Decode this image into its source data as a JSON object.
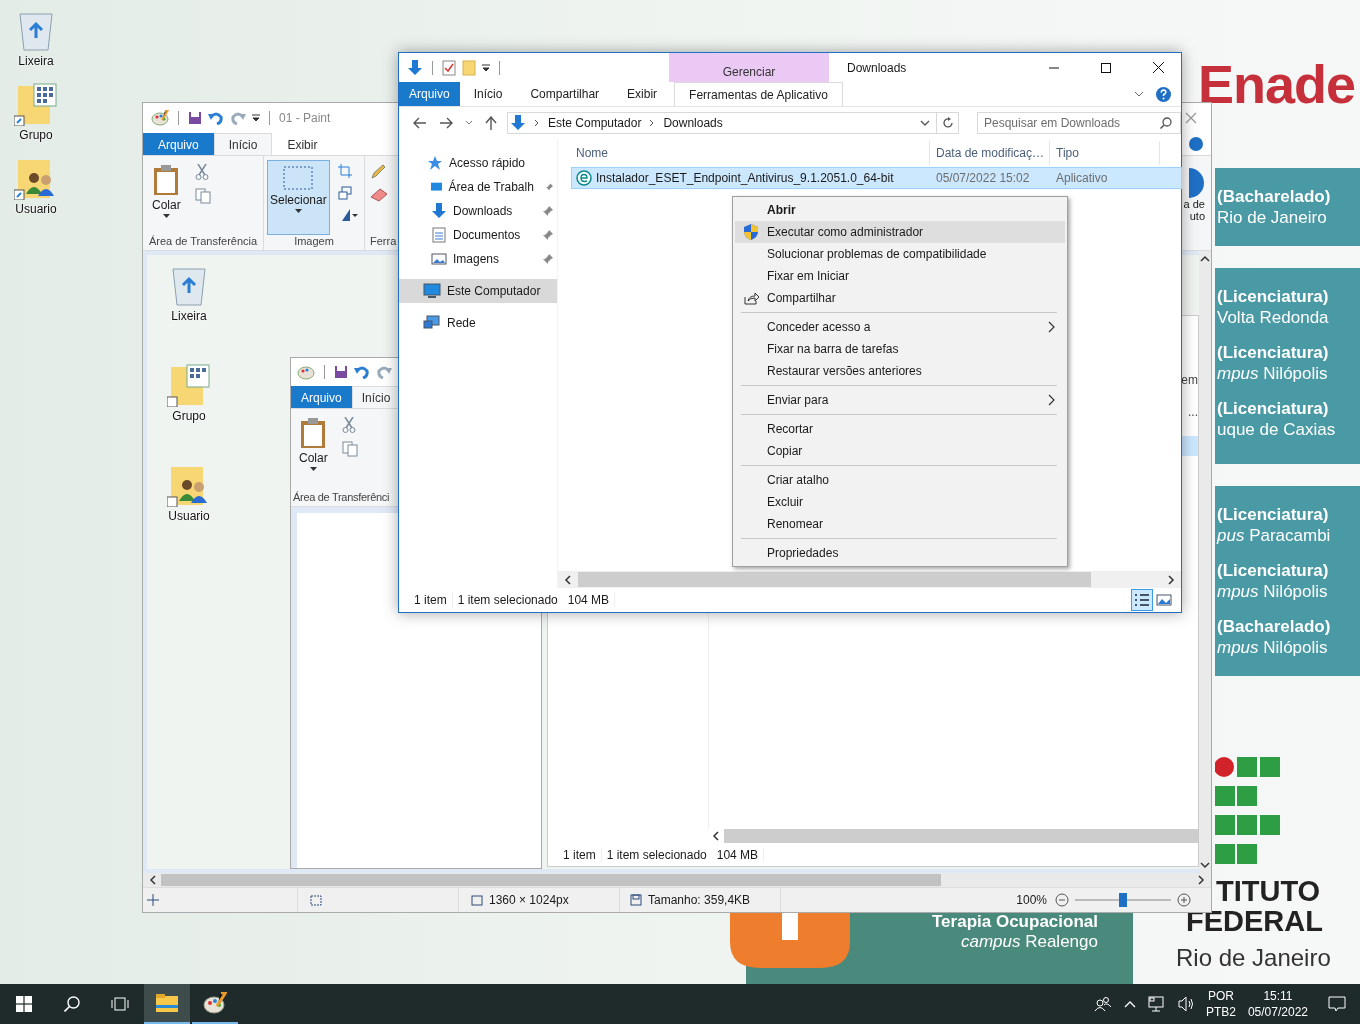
{
  "desktop_icons": [
    {
      "label": "Lixeira",
      "kind": "bin"
    },
    {
      "label": "Grupo",
      "kind": "group"
    },
    {
      "label": "Usuario",
      "kind": "user"
    }
  ],
  "poster": {
    "title": "Enade",
    "panels": [
      [
        {
          "course": "(Bacharelado)",
          "campus": "Rio de Janeiro"
        }
      ],
      [
        {
          "course": "(Licenciatura)",
          "campus": "Volta Redonda"
        },
        {
          "course": "(Licenciatura)",
          "campus": "*mpus* Nilópolis"
        },
        {
          "course": "(Licenciatura)",
          "campus": "uque de Caxias"
        }
      ],
      [
        {
          "course": "(Licenciatura)",
          "campus": "*pus* Paracambi"
        },
        {
          "course": "(Licenciatura)",
          "campus": "*mpus* Nilópolis"
        },
        {
          "course": "(Bacharelado)",
          "campus": "*mpus* Nilópolis"
        }
      ]
    ],
    "institute": [
      "TITUTO",
      "FEDERAL"
    ],
    "city": "Rio de Janeiro",
    "banner": {
      "title": "Terapia Ocupacional",
      "subtitle": "*campus* Realengo"
    }
  },
  "paint": {
    "title": "01 - Paint",
    "tabs": [
      {
        "label": "Arquivo",
        "kind": "file",
        "selected": false
      },
      {
        "label": "Início",
        "kind": "tab",
        "selected": true
      },
      {
        "label": "Exibir",
        "kind": "tab",
        "selected": false
      }
    ],
    "groups": [
      {
        "label": "Área de Transferência",
        "kind": "clipboard",
        "button": "Colar"
      },
      {
        "label": "Imagem",
        "kind": "image",
        "button": "Selecionar"
      },
      {
        "label": "Ferra",
        "kind": "tools"
      }
    ],
    "edge_labels": [
      "a de",
      "uto"
    ],
    "picture": {
      "icons": [
        {
          "label": "Lixeira",
          "kind": "bin"
        },
        {
          "label": "Grupo",
          "kind": "group"
        },
        {
          "label": "Usuario",
          "kind": "user"
        }
      ],
      "paint": {
        "tabs": [
          {
            "label": "Arquivo",
            "kind": "file",
            "selected": false
          },
          {
            "label": "Início",
            "kind": "tab",
            "selected": true
          }
        ],
        "button": "Colar",
        "group": "Área de Transferênci"
      },
      "explorer": {
        "edge_labels": [
          "em",
          "..."
        ],
        "status": [
          "1 item",
          "1 item selecionado",
          "104 MB"
        ]
      }
    },
    "status": {
      "dimensions": "1360 × 1024px",
      "size": "Tamanho: 359,4KB",
      "zoom": "100%",
      "level": 0.5
    }
  },
  "explorer": {
    "title": "Downloads",
    "context_tab": "Gerenciar",
    "tabs": [
      {
        "label": "Arquivo",
        "kind": "file"
      },
      {
        "label": "Início",
        "kind": "tab"
      },
      {
        "label": "Compartilhar",
        "kind": "tab"
      },
      {
        "label": "Exibir",
        "kind": "tab"
      },
      {
        "label": "Ferramentas de Aplicativo",
        "kind": "context"
      }
    ],
    "path": [
      "Este Computador",
      "Downloads"
    ],
    "search_placeholder": "Pesquisar em Downloads",
    "nav": [
      {
        "label": "Acesso rápido",
        "kind": "star",
        "pinned": false,
        "selected": false
      },
      {
        "label": "Área de Trabalh",
        "kind": "desktop",
        "pinned": true,
        "selected": false
      },
      {
        "label": "Downloads",
        "kind": "download",
        "pinned": true,
        "selected": false
      },
      {
        "label": "Documentos",
        "kind": "document",
        "pinned": true,
        "selected": false
      },
      {
        "label": "Imagens",
        "kind": "image",
        "pinned": true,
        "selected": false
      },
      {
        "label": "Este Computador",
        "kind": "computer",
        "pinned": false,
        "selected": true
      },
      {
        "label": "Rede",
        "kind": "network",
        "pinned": false,
        "selected": false
      }
    ],
    "columns": [
      "Nome",
      "Data de modificaç…",
      "Tipo"
    ],
    "files": [
      {
        "name": "Instalador_ESET_Endpoint_Antivirus_9.1.2051.0_64-bit",
        "date": "05/07/2022 15:02",
        "type": "Aplicativo",
        "selected": true
      }
    ],
    "status": [
      "1 item",
      "1 item selecionado",
      "104 MB"
    ],
    "views": [
      {
        "kind": "details",
        "selected": true
      },
      {
        "kind": "tiles",
        "selected": false
      }
    ]
  },
  "context_menu": [
    {
      "kind": "item",
      "label": "Abrir",
      "default": true,
      "selected": false,
      "submenu": false
    },
    {
      "kind": "admin",
      "label": "Executar como administrador",
      "default": false,
      "selected": true,
      "submenu": false
    },
    {
      "kind": "item",
      "label": "Solucionar problemas de compatibilidade",
      "default": false,
      "selected": false,
      "submenu": false
    },
    {
      "kind": "item",
      "label": "Fixar em Iniciar",
      "default": false,
      "selected": false,
      "submenu": false
    },
    {
      "kind": "share",
      "label": "Compartilhar",
      "default": false,
      "selected": false,
      "submenu": false
    },
    {
      "kind": "separator"
    },
    {
      "kind": "item",
      "label": "Conceder acesso a",
      "default": false,
      "selected": false,
      "submenu": true
    },
    {
      "kind": "item",
      "label": "Fixar na barra de tarefas",
      "default": false,
      "selected": false,
      "submenu": false
    },
    {
      "kind": "item",
      "label": "Restaurar versões anteriores",
      "default": false,
      "selected": false,
      "submenu": false
    },
    {
      "kind": "separator"
    },
    {
      "kind": "item",
      "label": "Enviar para",
      "default": false,
      "selected": false,
      "submenu": true
    },
    {
      "kind": "separator"
    },
    {
      "kind": "item",
      "label": "Recortar",
      "default": false,
      "selected": false,
      "submenu": false
    },
    {
      "kind": "item",
      "label": "Copiar",
      "default": false,
      "selected": false,
      "submenu": false
    },
    {
      "kind": "separator"
    },
    {
      "kind": "item",
      "label": "Criar atalho",
      "default": false,
      "selected": false,
      "submenu": false
    },
    {
      "kind": "item",
      "label": "Excluir",
      "default": false,
      "selected": false,
      "submenu": false
    },
    {
      "kind": "item",
      "label": "Renomear",
      "default": false,
      "selected": false,
      "submenu": false
    },
    {
      "kind": "separator"
    },
    {
      "kind": "item",
      "label": "Propriedades",
      "default": false,
      "selected": false,
      "submenu": false
    }
  ],
  "taskbar": {
    "apps": [
      {
        "kind": "explorer",
        "active": true,
        "focused": true
      },
      {
        "kind": "paint",
        "active": true,
        "focused": false
      }
    ],
    "language": [
      "POR",
      "PTB2"
    ],
    "time": "15:11",
    "date": "05/07/2022"
  }
}
